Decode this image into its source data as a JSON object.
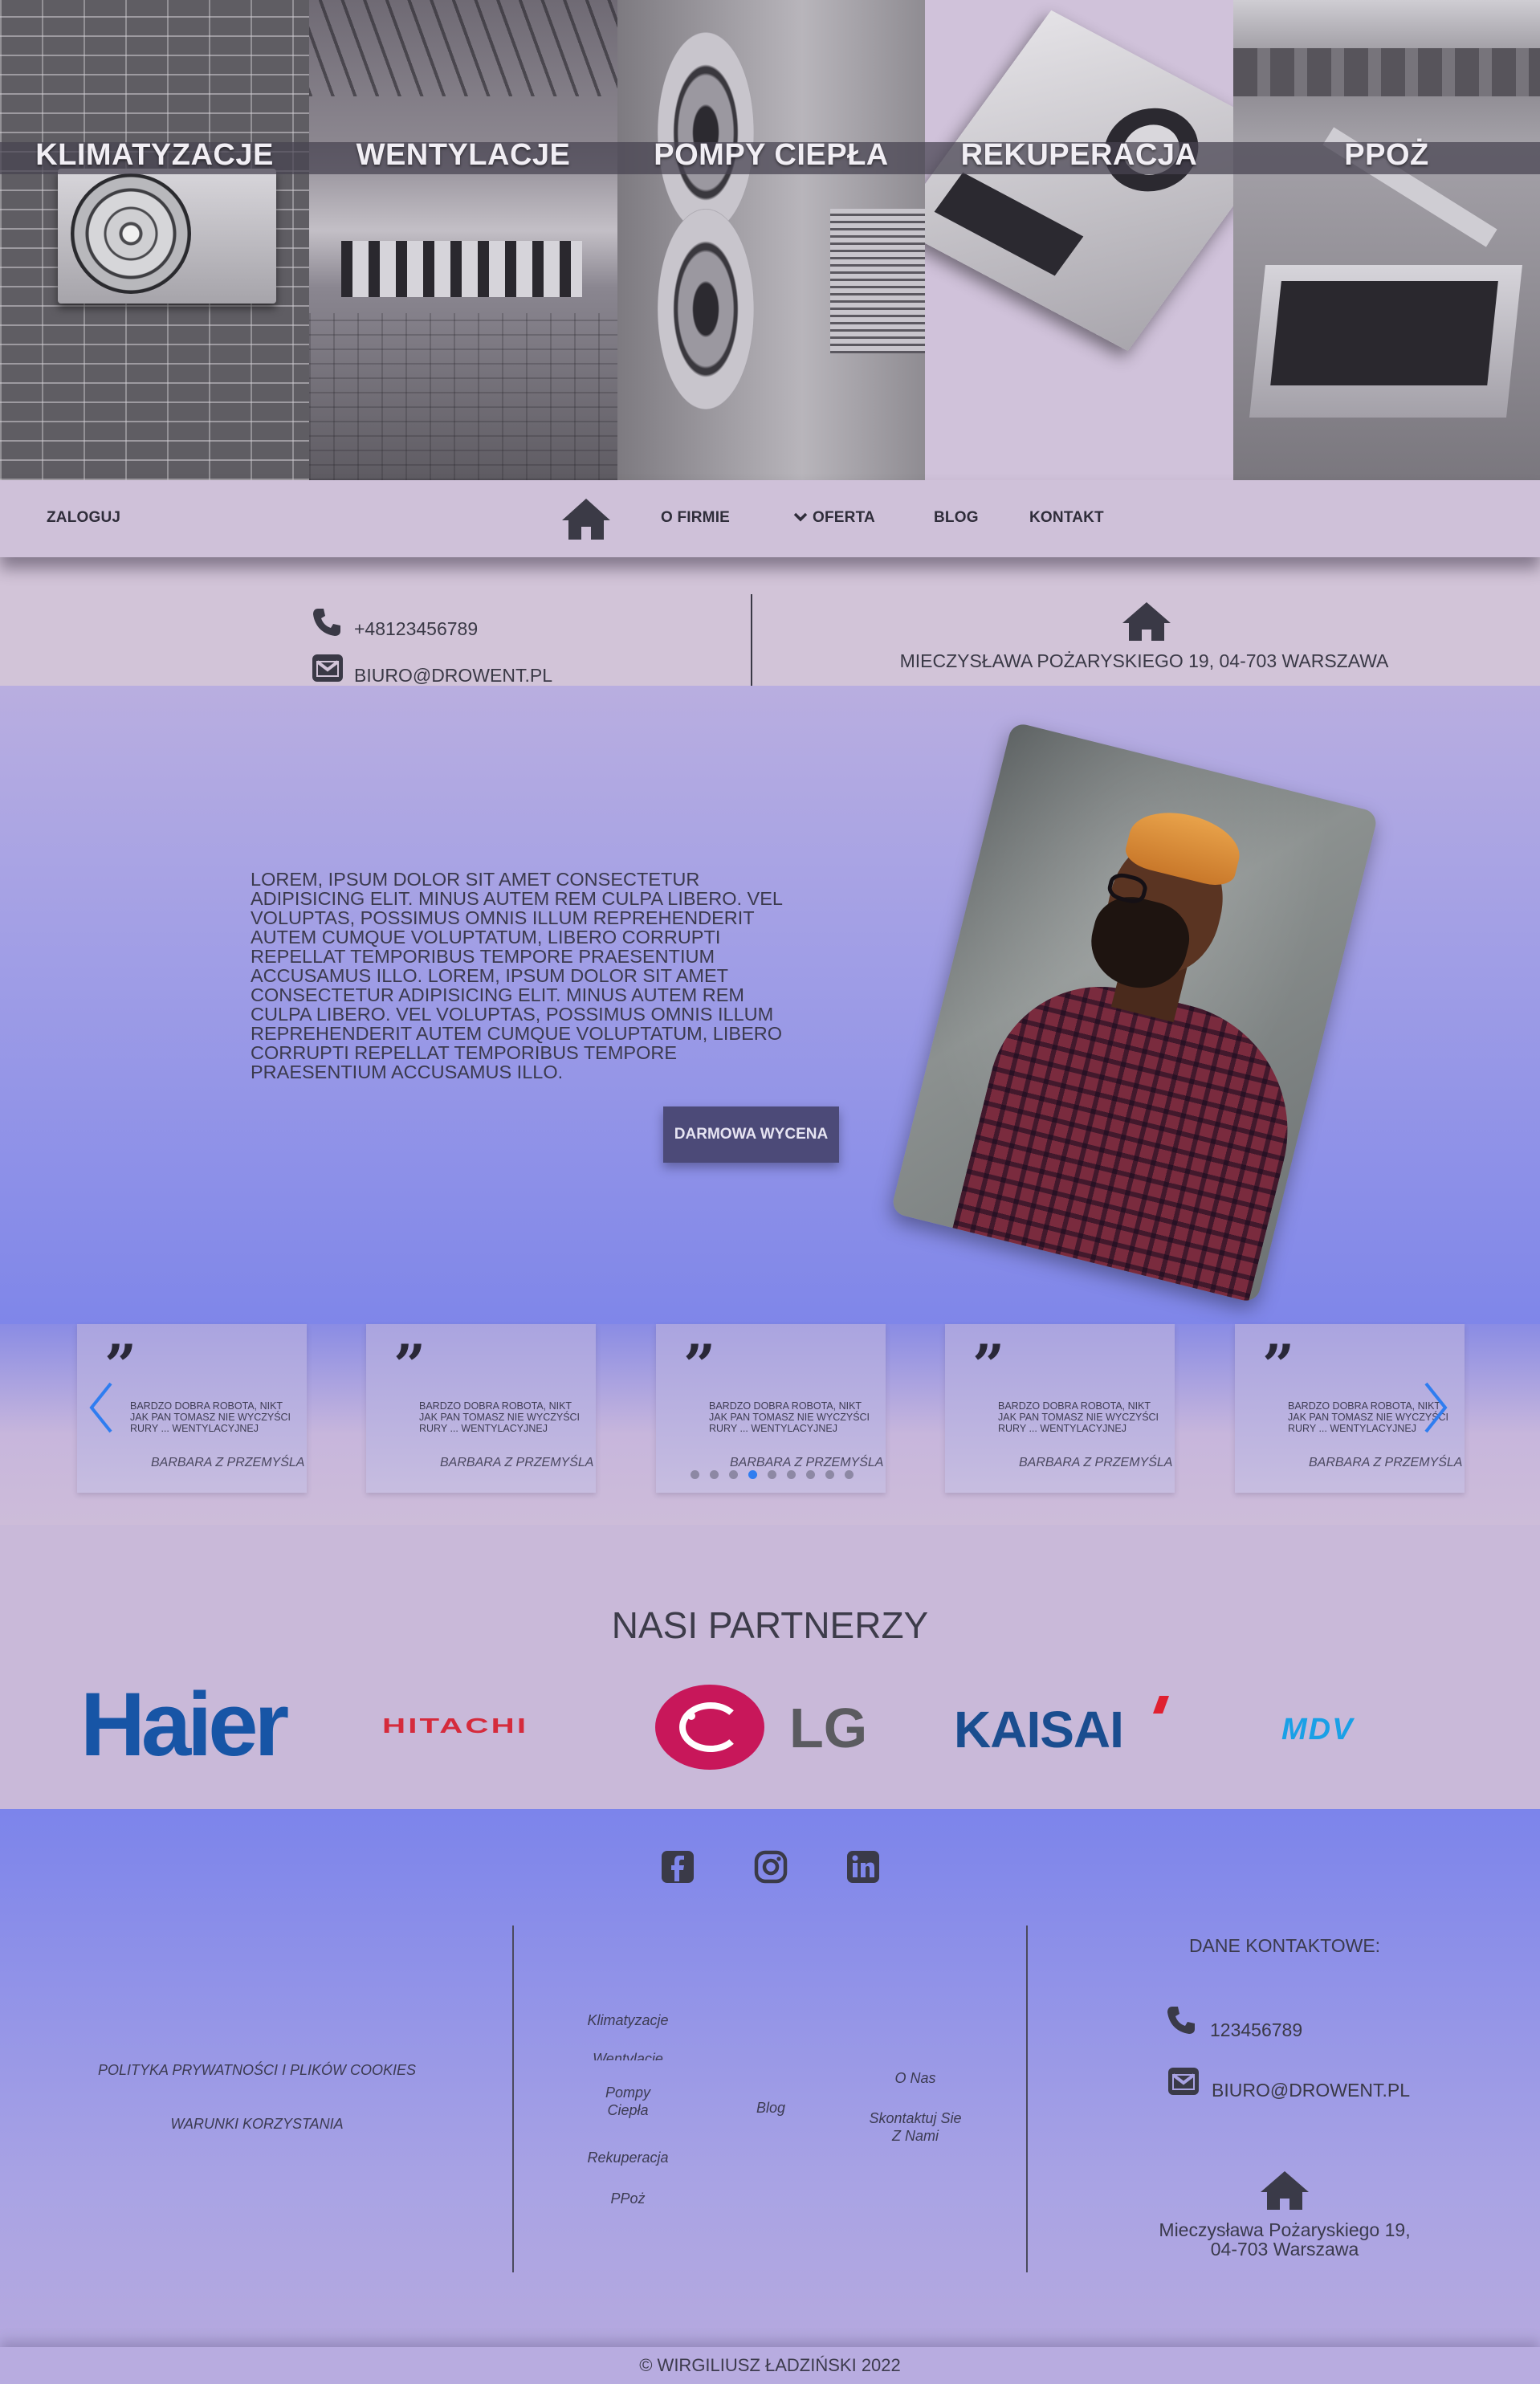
{
  "hero": {
    "tiles": [
      {
        "label": "KLIMATYZACJE"
      },
      {
        "label": "WENTYLACJE"
      },
      {
        "label": "POMPY CIEPŁA"
      },
      {
        "label": "REKUPERACJA"
      },
      {
        "label": "PPOŻ"
      }
    ]
  },
  "nav": {
    "login": "ZALOGUJ",
    "home_icon": "home-icon",
    "items": [
      {
        "label": "O FIRMIE"
      },
      {
        "label": "OFERTA"
      },
      {
        "label": "BLOG"
      },
      {
        "label": "KONTAKT"
      }
    ]
  },
  "contact": {
    "phone": "+48123456789",
    "email": "BIURO@DROWENT.PL",
    "address": "MIECZYSŁAWA POŻARYSKIEGO 19, 04-703 WARSZAWA"
  },
  "about": {
    "text": "LOREM, IPSUM DOLOR SIT AMET CONSECTETUR ADIPISICING ELIT. MINUS AUTEM REM CULPA LIBERO. VEL VOLUPTAS, POSSIMUS OMNIS ILLUM REPREHENDERIT AUTEM CUMQUE VOLUPTATUM, LIBERO CORRUPTI REPELLAT TEMPORIBUS TEMPORE PRAESENTIUM ACCUSAMUS ILLO. LOREM, IPSUM DOLOR SIT AMET CONSECTETUR ADIPISICING ELIT. MINUS AUTEM REM CULPA LIBERO. VEL VOLUPTAS, POSSIMUS OMNIS ILLUM REPREHENDERIT AUTEM CUMQUE VOLUPTATUM, LIBERO CORRUPTI REPELLAT TEMPORIBUS TEMPORE PRAESENTIUM ACCUSAMUS ILLO.",
    "cta": "DARMOWA WYCENA"
  },
  "testimonials": {
    "items": [
      {
        "text": "BARDZO DOBRA ROBOTA, NIKT JAK PAN TOMASZ NIE WYCZYŚCI RURY ... WENTYLACYJNEJ",
        "author": "BARBARA Z PRZEMYŚLA"
      },
      {
        "text": "BARDZO DOBRA ROBOTA, NIKT JAK PAN TOMASZ NIE WYCZYŚCI RURY ... WENTYLACYJNEJ",
        "author": "BARBARA Z PRZEMYŚLA"
      },
      {
        "text": "BARDZO DOBRA ROBOTA, NIKT JAK PAN TOMASZ NIE WYCZYŚCI RURY ... WENTYLACYJNEJ",
        "author": "BARBARA Z PRZEMYŚLA"
      },
      {
        "text": "BARDZO DOBRA ROBOTA, NIKT JAK PAN TOMASZ NIE WYCZYŚCI RURY ... WENTYLACYJNEJ",
        "author": "BARBARA Z PRZEMYŚLA"
      },
      {
        "text": "BARDZO DOBRA ROBOTA, NIKT JAK PAN TOMASZ NIE WYCZYŚCI RURY ... WENTYLACYJNEJ",
        "author": "BARBARA Z PRZEMYŚLA"
      }
    ],
    "dot_count": 9,
    "active_dot": 3
  },
  "partners": {
    "title": "NASI PARTNERZY",
    "logos": [
      "Haier",
      "HITACHI",
      "LG",
      "KAISAI",
      "MDV"
    ]
  },
  "footer": {
    "social": [
      "facebook-icon",
      "instagram-icon",
      "linkedin-icon"
    ],
    "policy": "POLITYKA PRYWATNOŚCI I PLIKÓW COOKIES",
    "terms": "WARUNKI KORZYSTANIA",
    "offer_links": [
      "Klimatyzacje",
      "Wentylacje",
      "Pompy Ciepła",
      "Rekuperacja",
      "PPoż"
    ],
    "blog": "Blog",
    "about": "O Nas",
    "contact_us": "Skontaktuj Sie Z Nami",
    "contact_title": "DANE KONTAKTOWE:",
    "phone": "123456789",
    "email": "BIURO@DROWENT.PL",
    "address": "Mieczysława Pożaryskiego 19, 04-703 Warszawa"
  },
  "copyright": "© WIRGILIUSZ ŁADZIŃSKI 2022"
}
